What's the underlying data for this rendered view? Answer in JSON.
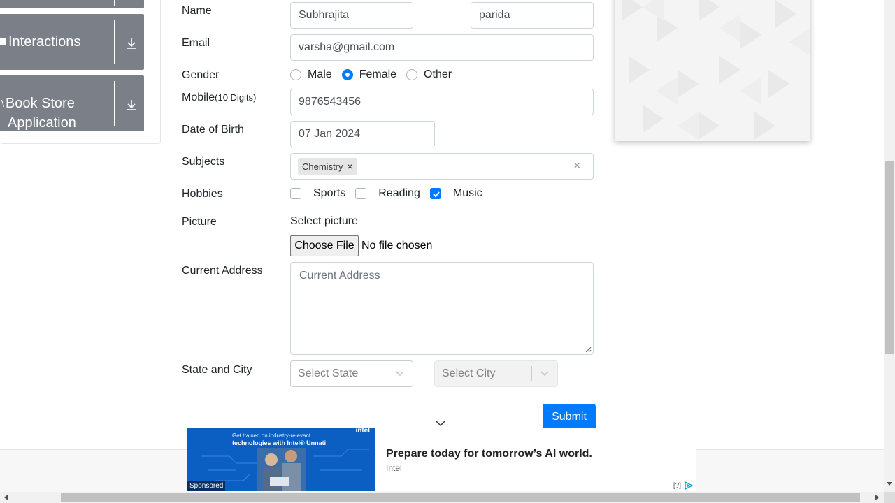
{
  "sidebar": {
    "cards": [
      {
        "label": "Interactions",
        "icon": "download-icon"
      },
      {
        "label_line1": "Book Store",
        "label_line2": "Application",
        "icon": "download-icon"
      }
    ]
  },
  "form": {
    "name": {
      "label": "Name",
      "first": "Subhrajita",
      "last": "parida"
    },
    "email": {
      "label": "Email",
      "value": "varsha@gmail.com"
    },
    "gender": {
      "label": "Gender",
      "options": [
        "Male",
        "Female",
        "Other"
      ],
      "selected": "Female"
    },
    "mobile": {
      "label": "Mobile",
      "hint": "(10 Digits)",
      "value": "9876543456"
    },
    "dob": {
      "label": "Date of Birth",
      "value": "07 Jan 2024"
    },
    "subjects": {
      "label": "Subjects",
      "chips": [
        "Chemistry"
      ],
      "remove_symbol": "×",
      "clear_symbol": "×"
    },
    "hobbies": {
      "label": "Hobbies",
      "options": [
        "Sports",
        "Reading",
        "Music"
      ],
      "checked": [
        "Music"
      ]
    },
    "picture": {
      "label": "Picture",
      "prompt": "Select picture",
      "button": "Choose File",
      "status": "No file chosen"
    },
    "address": {
      "label": "Current Address",
      "placeholder": "Current Address"
    },
    "state_city": {
      "label": "State and City",
      "state_placeholder": "Select State",
      "city_placeholder": "Select City"
    },
    "submit": "Submit"
  },
  "ad": {
    "image_line1": "Get trained on industry-relevant",
    "image_line2": "technologies with Intel® Unnati",
    "image_brand": "intel",
    "sponsored": "Sponsored",
    "headline": "Prepare today for tomorrow’s AI world.",
    "advertiser": "Intel",
    "info": "[?]"
  },
  "colors": {
    "accent": "#007bff",
    "sidebar_card": "#7b8088",
    "ad_blue": "#0b5fc2"
  }
}
